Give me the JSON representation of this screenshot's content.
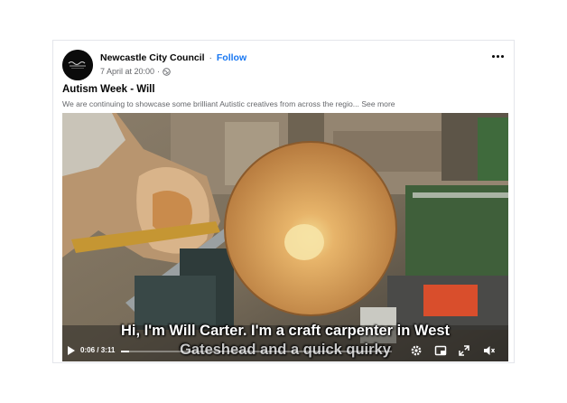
{
  "post": {
    "page_name": "Newcastle City Council",
    "separator": "·",
    "follow_label": "Follow",
    "timestamp": "7 April at 20:00",
    "meta_separator": "·",
    "title": "Autism Week - Will",
    "text": "We are continuing to showcase some brilliant Autistic creatives from across the regio...",
    "see_more_label": "See more",
    "privacy_icon": "globe-icon",
    "more_icon": "more-options-icon"
  },
  "video": {
    "subtitle_line1": "Hi, I'm Will Carter. I'm a craft carpenter in West",
    "subtitle_line2": "Gateshead and a quick quirky",
    "current_time": "0:06",
    "time_separator": "/",
    "duration": "3:11",
    "progress": 0.031,
    "icons": [
      "play-icon",
      "settings-icon",
      "picture-in-picture-icon",
      "fullscreen-icon",
      "volume-icon"
    ]
  },
  "colors": {
    "accent": "#1877f2",
    "text_primary": "#050505",
    "text_secondary": "#65676b"
  }
}
